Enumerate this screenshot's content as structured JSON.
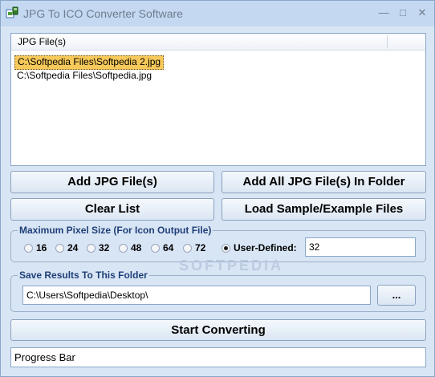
{
  "window": {
    "title": "JPG To ICO Converter Software",
    "minimize_glyph": "—",
    "maximize_glyph": "□",
    "close_glyph": "✕"
  },
  "file_list": {
    "column_header": "JPG File(s)",
    "rows": [
      {
        "path": "C:\\Softpedia Files\\Softpedia 2.jpg",
        "selected": true
      },
      {
        "path": "C:\\Softpedia Files\\Softpedia.jpg",
        "selected": false
      }
    ]
  },
  "buttons": {
    "add_files": "Add JPG File(s)",
    "add_all_in_folder": "Add All JPG File(s) In Folder",
    "clear_list": "Clear List",
    "load_samples": "Load Sample/Example Files",
    "browse": "...",
    "start": "Start Converting"
  },
  "pixel_size_group": {
    "title": "Maximum Pixel Size (For Icon Output File)",
    "options": [
      "16",
      "24",
      "32",
      "48",
      "64",
      "72"
    ],
    "user_defined_label": "User-Defined:",
    "selected": "User-Defined:",
    "user_defined_value": "32"
  },
  "save_group": {
    "title": "Save Results To This Folder",
    "folder_value": "C:\\Users\\Softpedia\\Desktop\\"
  },
  "progress": {
    "label": "Progress Bar"
  },
  "watermark": "SOFTPEDIA",
  "colors": {
    "window_bg": "#c4d9f1",
    "client_bg": "#d8e5f4",
    "selection": "#f7c95a",
    "group_title": "#1f3f78"
  }
}
